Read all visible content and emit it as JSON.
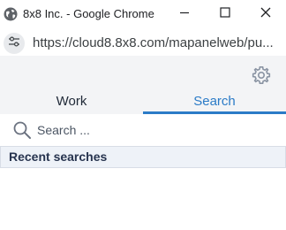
{
  "window": {
    "title": "8x8 Inc. - Google Chrome",
    "icon": "globe-icon",
    "controls": [
      "minimize-icon",
      "maximize-icon",
      "close-icon"
    ]
  },
  "address_bar": {
    "site_info_icon": "tune-icon",
    "url": "https://cloud8.8x8.com/mapanelweb/pu..."
  },
  "app": {
    "settings_icon": "gear-icon",
    "tabs": [
      {
        "label": "Work",
        "active": false
      },
      {
        "label": "Search",
        "active": true
      }
    ],
    "accent_color": "#2b7bc7",
    "search": {
      "icon": "search-icon",
      "placeholder": "Search ...",
      "value": ""
    },
    "recent_searches": {
      "label": "Recent searches"
    }
  }
}
